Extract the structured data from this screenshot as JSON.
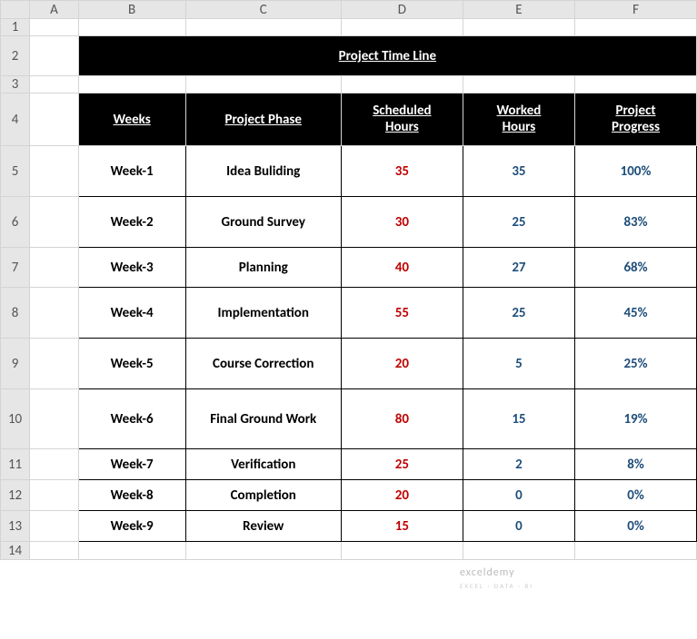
{
  "columns": [
    "",
    "A",
    "B",
    "C",
    "D",
    "E",
    "F"
  ],
  "row_labels": [
    "1",
    "2",
    "3",
    "4",
    "5",
    "6",
    "7",
    "8",
    "9",
    "10",
    "11",
    "12",
    "13",
    "14"
  ],
  "title": "Project Time Line",
  "headers": {
    "weeks": "Weeks",
    "phase": "Project Phase",
    "scheduled_l1": "Scheduled",
    "scheduled_l2": "Hours",
    "worked_l1": "Worked",
    "worked_l2": "Hours",
    "progress_l1": "Project",
    "progress_l2": "Progress"
  },
  "rows": [
    {
      "week": "Week-1",
      "phase": "Idea Buliding",
      "scheduled": "35",
      "worked": "35",
      "progress": "100%"
    },
    {
      "week": "Week-2",
      "phase": "Ground Survey",
      "scheduled": "30",
      "worked": "25",
      "progress": "83%"
    },
    {
      "week": "Week-3",
      "phase": "Planning",
      "scheduled": "40",
      "worked": "27",
      "progress": "68%"
    },
    {
      "week": "Week-4",
      "phase": "Implementation",
      "scheduled": "55",
      "worked": "25",
      "progress": "45%"
    },
    {
      "week": "Week-5",
      "phase": "Course Correction",
      "scheduled": "20",
      "worked": "5",
      "progress": "25%"
    },
    {
      "week": "Week-6",
      "phase": "Final Ground Work",
      "scheduled": "80",
      "worked": "15",
      "progress": "19%"
    },
    {
      "week": "Week-7",
      "phase": "Verification",
      "scheduled": "25",
      "worked": "2",
      "progress": "8%"
    },
    {
      "week": "Week-8",
      "phase": "Completion",
      "scheduled": "20",
      "worked": "0",
      "progress": "0%"
    },
    {
      "week": "Week-9",
      "phase": "Review",
      "scheduled": "15",
      "worked": "0",
      "progress": "0%"
    }
  ],
  "watermark": {
    "main": "exceldemy",
    "sub": "EXCEL · DATA · BI"
  },
  "chart_data": {
    "type": "table",
    "title": "Project Time Line",
    "categories": [
      "Week-1",
      "Week-2",
      "Week-3",
      "Week-4",
      "Week-5",
      "Week-6",
      "Week-7",
      "Week-8",
      "Week-9"
    ],
    "series": [
      {
        "name": "Scheduled Hours",
        "values": [
          35,
          30,
          40,
          55,
          20,
          80,
          25,
          20,
          15
        ]
      },
      {
        "name": "Worked Hours",
        "values": [
          35,
          25,
          27,
          25,
          5,
          15,
          2,
          0,
          0
        ]
      },
      {
        "name": "Project Progress (%)",
        "values": [
          100,
          83,
          68,
          45,
          25,
          19,
          8,
          0,
          0
        ]
      }
    ],
    "xlabel": "Weeks",
    "ylabel": ""
  }
}
